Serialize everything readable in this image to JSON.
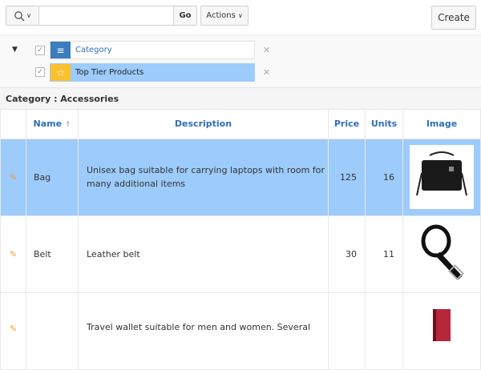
{
  "toolbar": {
    "go": "Go",
    "actions": "Actions",
    "create": "Create",
    "search_value": ""
  },
  "filters": [
    {
      "label": "Category",
      "icon": "list-icon",
      "color": "#3c7dbf"
    },
    {
      "label": "Top Tier Products",
      "icon": "star-icon",
      "color": "#fbc02d"
    }
  ],
  "group_label": "Category : Accessories",
  "columns": {
    "name": "Name",
    "description": "Description",
    "price": "Price",
    "units": "Units",
    "image": "Image"
  },
  "rows": [
    {
      "name": "Bag",
      "description": "Unisex bag suitable for carrying laptops with room for many additional items",
      "price": "125",
      "units": "16",
      "selected": true
    },
    {
      "name": "Belt",
      "description": "Leather belt",
      "price": "30",
      "units": "11"
    },
    {
      "name": "",
      "description": "Travel wallet suitable for men and women. Several",
      "price": "",
      "units": ""
    }
  ]
}
